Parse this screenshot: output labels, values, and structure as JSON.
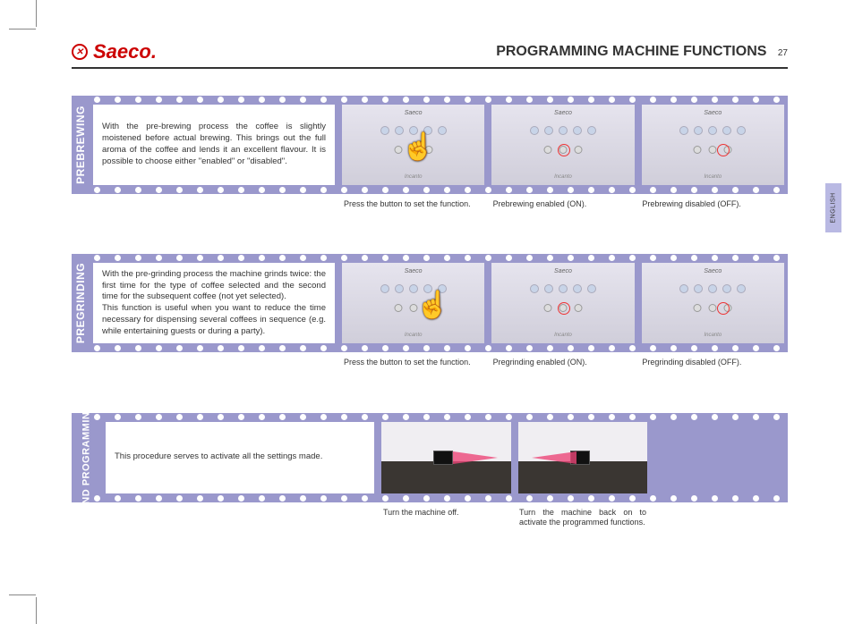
{
  "header": {
    "logo_text": "Saeco",
    "title": "PROGRAMMING MACHINE FUNCTIONS",
    "page_number": "27",
    "language_tab": "ENGLISH"
  },
  "sections": [
    {
      "label": "PREBREWING",
      "description": "With the pre-brewing process the coffee is slightly moistened before actual brewing. This brings out the full aroma of the coffee and lends it an excellent flavour. It is possible to choose either \"enabled\" or \"disabled\".",
      "captions": [
        "Press the button to set the function.",
        "Prebrewing enabled (ON).",
        "Prebrewing disabled (OFF)."
      ],
      "panel_brand": "Saeco",
      "panel_model": "Incanto"
    },
    {
      "label": "PREGRINDING",
      "description": "With the pre-grinding process the machine grinds twice: the first time for the type of coffee selected and the second time for the subsequent coffee (not yet selected).\nThis function is useful when you want to reduce the time necessary for dispensing several coffees in sequence (e.g. while entertaining guests or during a party).",
      "captions": [
        "Press the button to set the function.",
        "Pregrinding enabled (ON).",
        "Pregrinding disabled (OFF)."
      ],
      "panel_brand": "Saeco",
      "panel_model": "Incanto"
    },
    {
      "label": "END PROGRAMMING",
      "description": "This procedure serves to activate all the settings made.",
      "captions": [
        "Turn the machine off.",
        "Turn the machine back on to activate the programmed functions."
      ]
    }
  ]
}
